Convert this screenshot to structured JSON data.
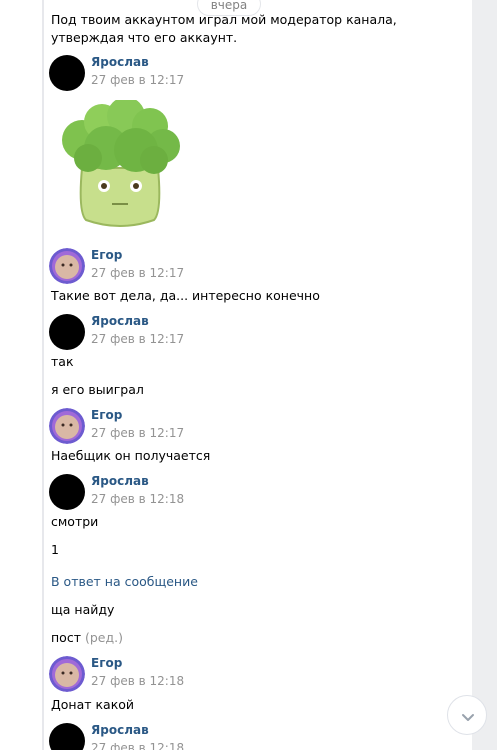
{
  "date_separator": "вчера",
  "messages": [
    {
      "text1": "Под твоим аккаунтом играл мой модератор канала,",
      "text2": "утверждая что его аккаунт."
    },
    {
      "author": "Ярослав",
      "time": "27 фев в 12:17"
    },
    {
      "author": "Егор",
      "time": "27 фев в 12:17",
      "text": "Такие вот дела, да... интересно конечно"
    },
    {
      "author": "Ярослав",
      "time": "27 фев в 12:17",
      "text1": "так",
      "text2": "я его выиграл"
    },
    {
      "author": "Егор",
      "time": "27 фев в 12:17",
      "text": "Наебщик он получается"
    },
    {
      "author": "Ярослав",
      "time": "27 фев в 12:18",
      "text1": "смотри",
      "text2": "1",
      "reply_link": "В ответ на сообщение",
      "text3": "ща найду",
      "text4": "пост",
      "edited": "(ред.)"
    },
    {
      "author": "Егор",
      "time": "27 фев в 12:18",
      "text": "Донат какой"
    },
    {
      "author": "Ярослав",
      "time": "27 фев в 12:18"
    }
  ],
  "icons": {
    "scroll_down": "chevron-down-icon",
    "sticker": "broccoli-sticker-icon"
  },
  "colors": {
    "author_link": "#2a5885",
    "time": "#939393",
    "background": "#edeef0"
  }
}
